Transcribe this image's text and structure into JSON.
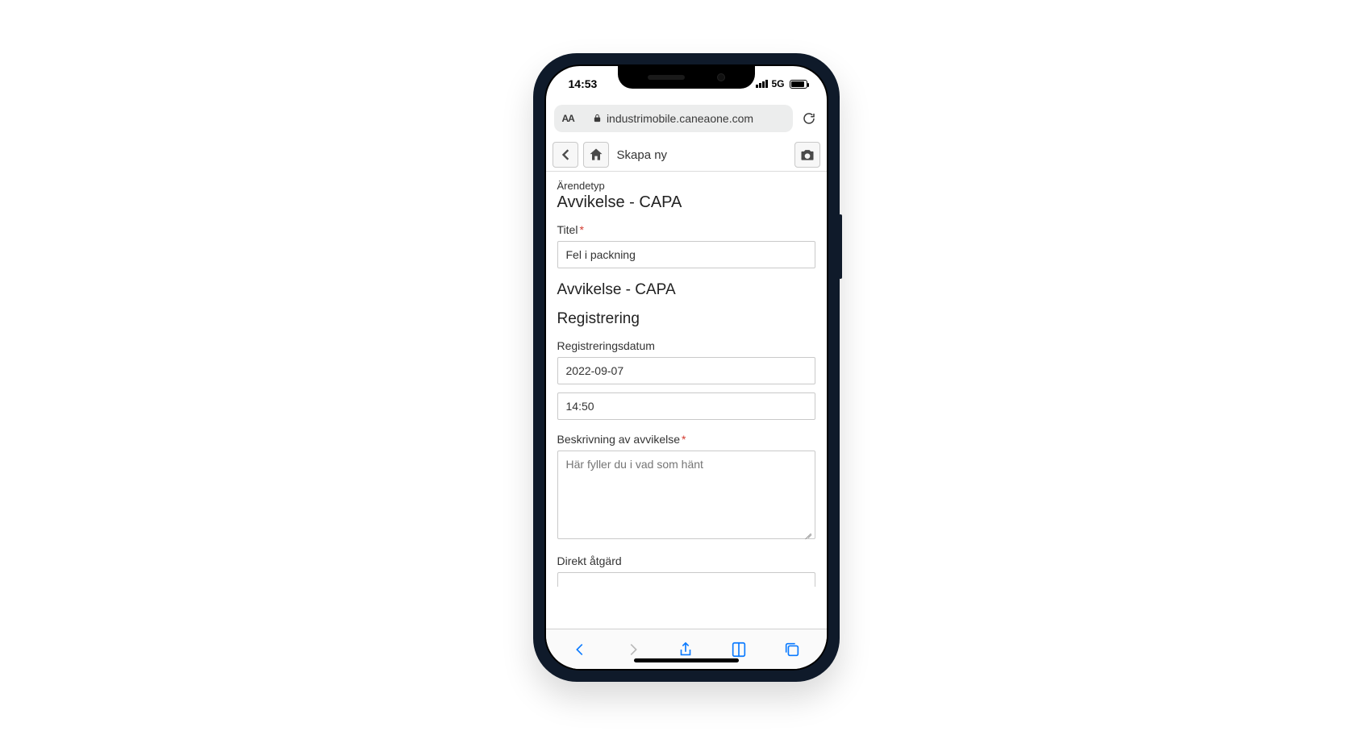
{
  "status": {
    "time": "14:53",
    "network": "5G"
  },
  "browser": {
    "text_size_label": "AA",
    "url": "industrimobile.caneaone.com"
  },
  "app_header": {
    "title": "Skapa ny"
  },
  "form": {
    "case_type_label": "Ärendetyp",
    "case_type_value": "Avvikelse - CAPA",
    "title_label": "Titel",
    "title_value": "Fel i packning",
    "section1": "Avvikelse - CAPA",
    "section2": "Registrering",
    "reg_date_label": "Registreringsdatum",
    "reg_date_value": "2022-09-07",
    "reg_time_value": "14:50",
    "desc_label": "Beskrivning av avvikelse",
    "desc_placeholder": "Här fyller du i vad som hänt",
    "direct_action_label": "Direkt åtgärd"
  }
}
